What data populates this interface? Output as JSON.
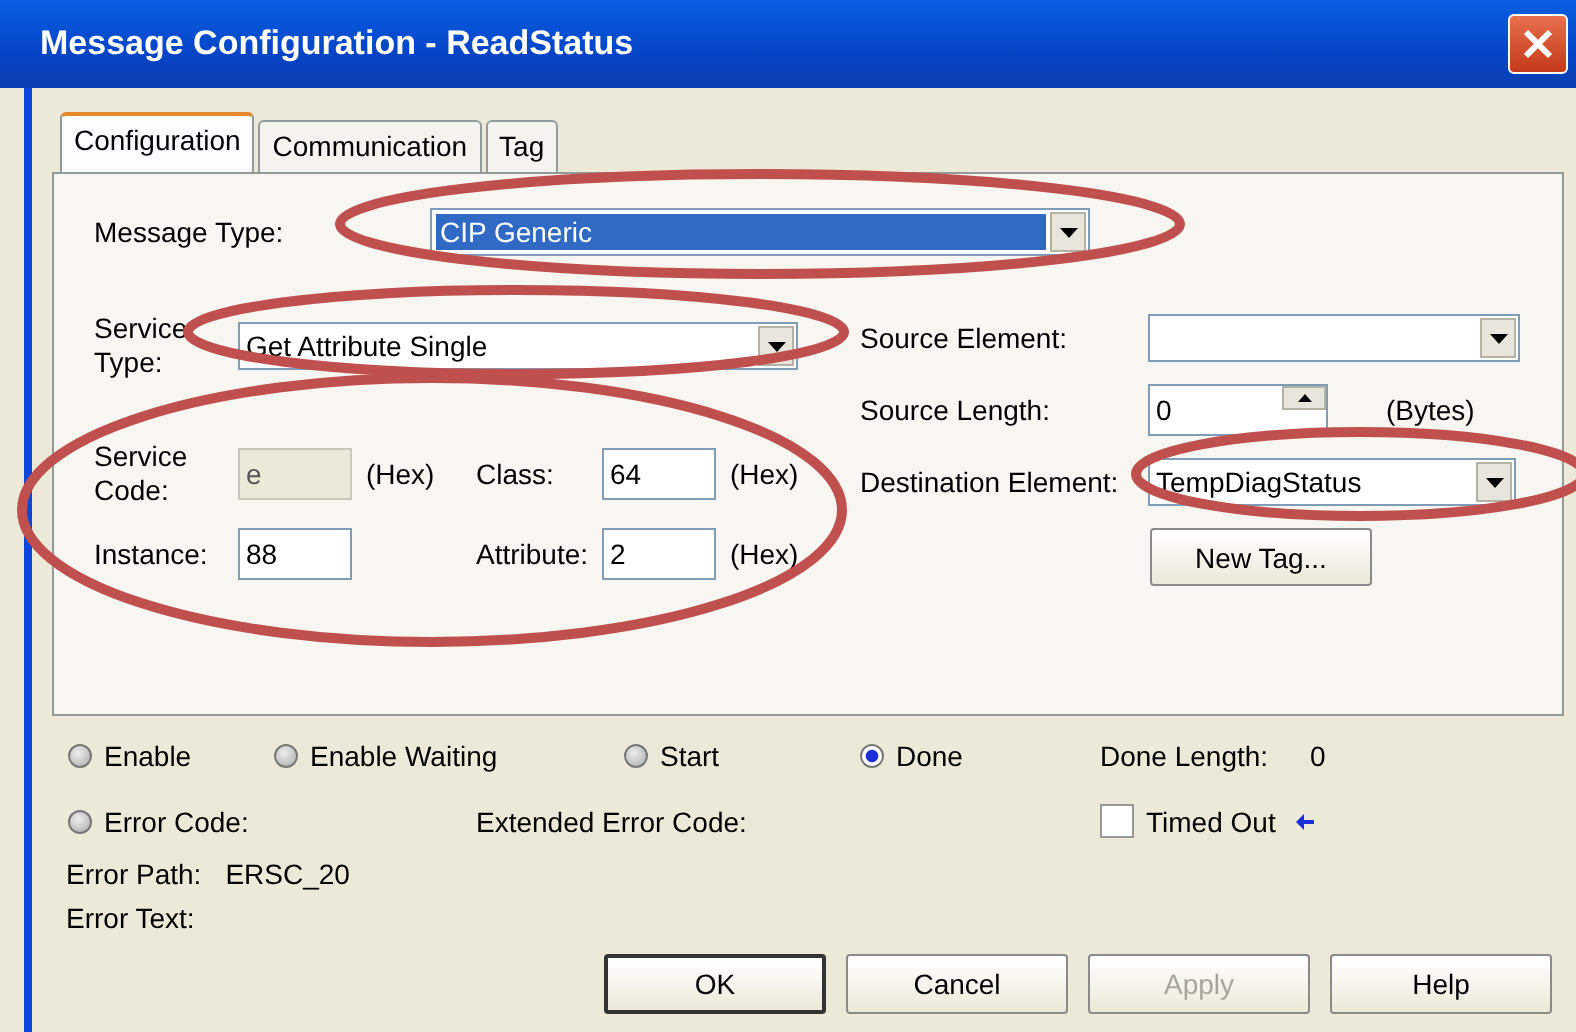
{
  "window": {
    "title": "Message Configuration - ReadStatus"
  },
  "tabs": [
    {
      "label": "Configuration",
      "selected": true
    },
    {
      "label": "Communication",
      "selected": false
    },
    {
      "label": "Tag",
      "selected": false
    }
  ],
  "message_type": {
    "label": "Message Type:",
    "value": "CIP Generic",
    "highlighted": true
  },
  "service_type": {
    "label": "Service Type:",
    "value": "Get Attribute Single",
    "highlighted": true
  },
  "parameters": {
    "highlighted": true,
    "fields": [
      {
        "label": "Service Code:",
        "value": "e",
        "unit": "(Hex)",
        "disabled": true
      },
      {
        "label": "Class:",
        "value": "64",
        "unit": "(Hex)",
        "disabled": false
      },
      {
        "label": "Instance:",
        "value": "88",
        "disabled": false
      },
      {
        "label": "Attribute:",
        "value": "2",
        "unit": "(Hex)",
        "disabled": false
      }
    ]
  },
  "source_element": {
    "label": "Source Element:"
  },
  "source_length": {
    "label": "Source Length:",
    "value": "0",
    "unit": "(Bytes)"
  },
  "destination_element": {
    "label": "Destination Element:",
    "value": "TempDiagStatus",
    "highlighted": true
  },
  "new_tag_button": "New Tag...",
  "status_flags": [
    {
      "label": "Enable",
      "on": false
    },
    {
      "label": "Enable Waiting",
      "on": false
    },
    {
      "label": "Start",
      "on": false
    },
    {
      "label": "Done",
      "on": true
    }
  ],
  "done_length": {
    "label": "Done Length:",
    "value": "0"
  },
  "error_code": {
    "label": "Error Code:",
    "on": false
  },
  "extended_error_code": {
    "label": "Extended Error Code:"
  },
  "timed_out": {
    "label": "Timed Out",
    "checked": false
  },
  "error_path": {
    "label": "Error Path:",
    "value": "ERSC_20"
  },
  "error_text": {
    "label": "Error Text:"
  },
  "buttons": [
    {
      "label": "OK",
      "default": true,
      "disabled": false
    },
    {
      "label": "Cancel",
      "default": false,
      "disabled": false
    },
    {
      "label": "Apply",
      "default": false,
      "disabled": true
    },
    {
      "label": "Help",
      "default": false,
      "disabled": false
    }
  ]
}
